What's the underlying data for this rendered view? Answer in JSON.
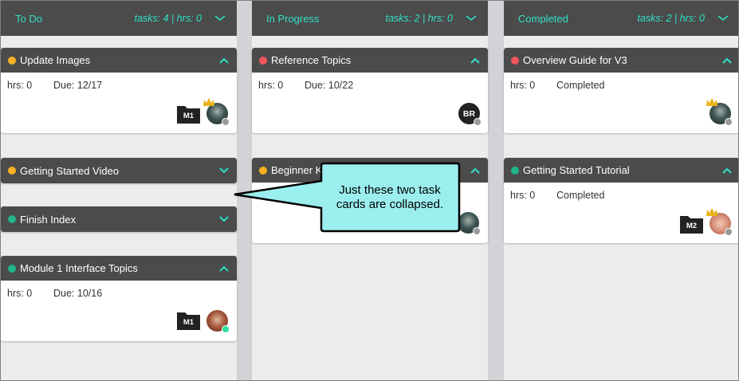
{
  "colors": {
    "accent": "#2fe0c6",
    "header_bg": "#4b4b4b",
    "dot_orange": "#f6b021",
    "dot_red": "#f0575a",
    "dot_green": "#22b48c",
    "callout_bg": "#9beeee"
  },
  "columns": [
    {
      "title": "To Do",
      "stats": "tasks: 4 | hrs: 0",
      "cards": [
        {
          "title": "Update Images",
          "dot": "orange",
          "collapsed": false,
          "hrs": "hrs: 0",
          "due": "Due: 12/17",
          "folder": "M1",
          "avatar": "photo-dark",
          "avatar_crown": true,
          "avatar_status": "gray"
        },
        {
          "title": "Getting Started Video",
          "dot": "orange",
          "collapsed": true
        },
        {
          "title": "Finish Index",
          "dot": "green",
          "collapsed": true
        },
        {
          "title": "Module 1 Interface Topics",
          "dot": "green",
          "collapsed": false,
          "hrs": "hrs: 0",
          "due": "Due: 10/16",
          "folder": "M1",
          "avatar": "photo-red",
          "avatar_crown": false,
          "avatar_status": "green"
        }
      ]
    },
    {
      "title": "In Progress",
      "stats": "tasks: 2 | hrs: 0",
      "cards": [
        {
          "title": "Reference Topics",
          "dot": "red",
          "collapsed": false,
          "hrs": "hrs: 0",
          "due": "Due: 10/22",
          "avatar_initials": "BR",
          "avatar_status": "gray"
        },
        {
          "title": "Beginner Ki",
          "dot": "orange",
          "collapsed": false
        }
      ]
    },
    {
      "title": "Completed",
      "stats": "tasks: 2 | hrs: 0",
      "cards": [
        {
          "title": "Overview Guide for V3",
          "dot": "red",
          "collapsed": false,
          "hrs": "hrs: 0",
          "due": "Completed",
          "avatar": "photo-dark",
          "avatar_crown": true,
          "avatar_status": "gray"
        },
        {
          "title": "Getting Started Tutorial",
          "dot": "green",
          "collapsed": false,
          "hrs": "hrs: 0",
          "due": "Completed",
          "folder": "M2",
          "avatar": "photo-face",
          "avatar_crown": true,
          "avatar_status": "gray"
        }
      ]
    }
  ],
  "callout": {
    "text": "Just these two task cards are collapsed."
  },
  "icons": {
    "expand": "chevron-up-icon",
    "collapse": "chevron-down-icon",
    "folder": "folder-icon",
    "crown": "crown-icon"
  }
}
